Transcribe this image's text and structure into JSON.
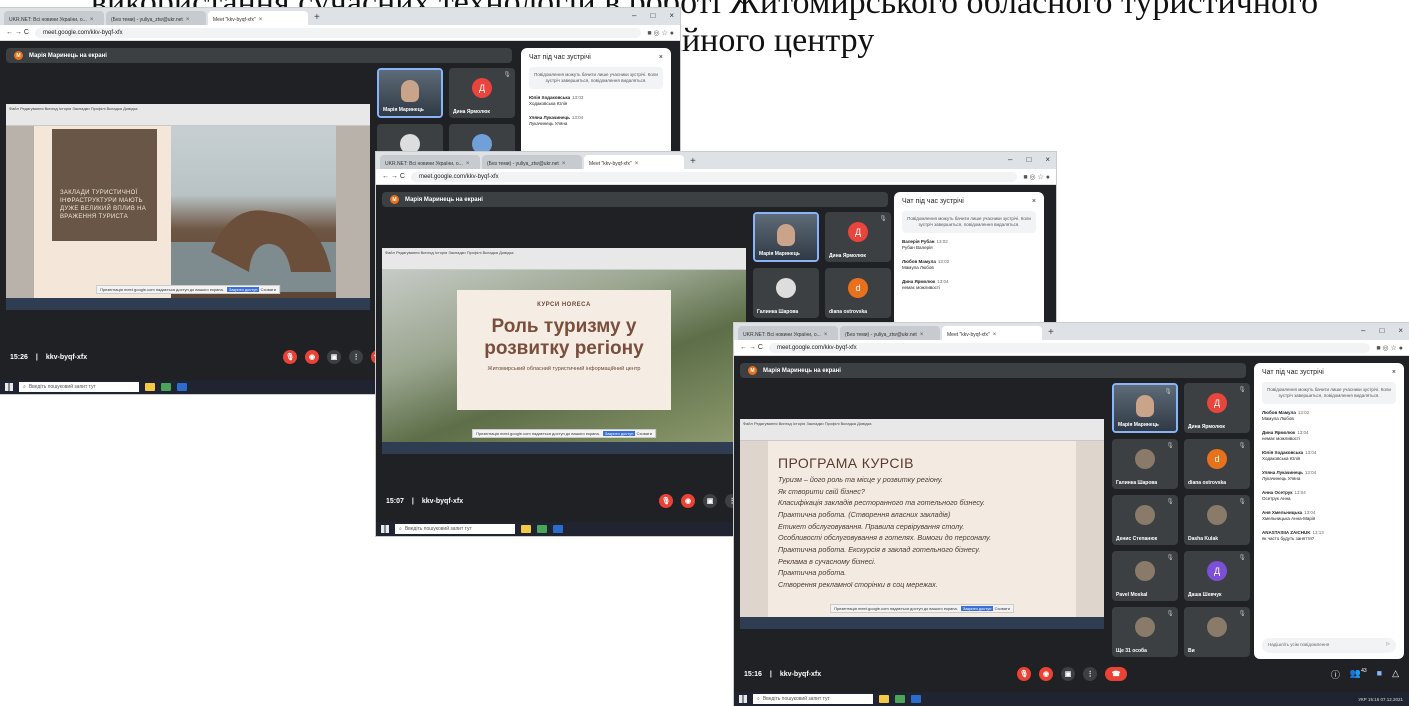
{
  "page_heading": "використання сучасних технологій в роботі Житомирського обласного туристичного інформаційного центру",
  "browser": {
    "tabs": [
      "UKR.NET: Всі новини України, о...",
      "(Без теми) - yuliya_ztw@ukr.net",
      "Meet \"kkv-byqf-xfx\""
    ],
    "new_tab": "+",
    "url": "meet.google.com/kkv-byqf-xfx",
    "nav_icons": "← → C",
    "window_controls": [
      "–",
      "□",
      "×"
    ]
  },
  "meet": {
    "presenter_banner": "Марія Маринець на екрані",
    "presenter_initial": "М",
    "meeting_code": "kkv-byqf-xfx",
    "chat_title": "Чат під час зустрічі",
    "chat_close": "×",
    "chat_notice": "Повідомлення можуть бачити лише учасники зустрічі. Коли зустріч завершиться, повідомлення видаляться.",
    "chat_input_placeholder": "Надішліть усім повідомлення",
    "send_icon": "▷",
    "participants_count": "43"
  },
  "shot1": {
    "time": "15:26",
    "slide_text": "ЗАКЛАДИ ТУРИСТИЧНОЇ ІНФРАСТРУКТУРИ МАЮТЬ ДУЖЕ ВЕЛИКИЙ ВПЛИВ НА ВРАЖЕННЯ ТУРИСТА",
    "tiles": [
      {
        "name": "Марія Маринець",
        "initial": ""
      },
      {
        "name": "Дина Ярмолюк",
        "initial": "Д"
      }
    ],
    "messages": [
      {
        "who": "Юлія Ходаковська",
        "time": "13:03",
        "text": "Ходаковська Юлія"
      },
      {
        "who": "Уляна Лукачинець",
        "time": "13:04",
        "text": "Лукачинець Уляна"
      }
    ]
  },
  "shot2": {
    "time": "15:07",
    "slide_kicker": "КУРСИ HORECA",
    "slide_title": "Роль туризму у розвитку регіону",
    "slide_sub": "Житомирський обласний туристичний інформаційний центр",
    "tiles": [
      {
        "name": "Марія Маринець",
        "initial": ""
      },
      {
        "name": "Дина Ярмолюк",
        "initial": "Д"
      },
      {
        "name": "Галинка Шарова",
        "initial": ""
      },
      {
        "name": "diana ostrovska",
        "initial": "d"
      }
    ],
    "messages": [
      {
        "who": "Валерія Рубан",
        "time": "13:02",
        "text": "Рубан Валерія"
      },
      {
        "who": "Любов Мамула",
        "time": "13:02",
        "text": "Мамула Любов"
      },
      {
        "who": "Дина Ярмолюк",
        "time": "13:04",
        "text": "немає можливості"
      }
    ]
  },
  "shot3": {
    "time": "15:16",
    "slide_title": "ПРОГРАМА КУРСІВ",
    "program_lines": [
      "Туризм – його роль та місце у розвитку регіону.",
      "Як створити свій бізнес?",
      "Класифікація закладів ресторанного та готельного бізнесу.",
      "Практична робота. (Створення власних закладів)",
      "Етикет обслуговування. Правила сервірування столу.",
      "Особливості обслуговування в готелях. Вимоги до персоналу.",
      "Практична робота. Екскурсія в заклад готельного бізнесу.",
      "Реклама в сучасному бізнесі.",
      "Практична робота.",
      "Створення рекламної сторінки в соц мережах."
    ],
    "tiles": [
      {
        "name": "Марія Маринець",
        "initial": ""
      },
      {
        "name": "Дина Ярмолюк",
        "initial": "Д"
      },
      {
        "name": "Галинка Шарова",
        "initial": ""
      },
      {
        "name": "diana ostrovska",
        "initial": "d"
      },
      {
        "name": "Денис Степанюк",
        "initial": ""
      },
      {
        "name": "Dasha Kulak",
        "initial": ""
      },
      {
        "name": "Pavel Moskal",
        "initial": ""
      },
      {
        "name": "Даша Шевчук",
        "initial": "Д"
      },
      {
        "name": "Ще 31 особа",
        "initial": ""
      },
      {
        "name": "Ви",
        "initial": ""
      }
    ],
    "messages": [
      {
        "who": "Любов Мамула",
        "time": "13:02",
        "text": "Мамула Любов"
      },
      {
        "who": "Дина Ярмолюк",
        "time": "13:04",
        "text": "немає можливості"
      },
      {
        "who": "Юлія Ходаковська",
        "time": "13:04",
        "text": "Ходаковська Юлія"
      },
      {
        "who": "Уляна Лукачинець",
        "time": "13:04",
        "text": "Лукачинець Уляна"
      },
      {
        "who": "Анна Осетрук",
        "time": "13:04",
        "text": "Осетрук Анна"
      },
      {
        "who": "Аня Хмельницька",
        "time": "13:04",
        "text": "Хмельницька Анна-Марія"
      },
      {
        "who": "ANASTASIIA ZAICHUK",
        "time": "13:13",
        "text": "як часто будуть заняття?"
      }
    ],
    "clock": "15:16 07.12.2021",
    "lang": "УКР"
  },
  "taskbar": {
    "search_placeholder": "Введіть пошуковий запит тут"
  },
  "share_notice": {
    "text": "Презентація meet.google.com надається доступ до вашого екрана.",
    "stop": "Закрити доступ",
    "hide": "Сховати"
  },
  "colors": {
    "meet_bg": "#202124",
    "red": "#ea4335",
    "tile": "#3c4043",
    "highlight": "#8ab4f8"
  }
}
